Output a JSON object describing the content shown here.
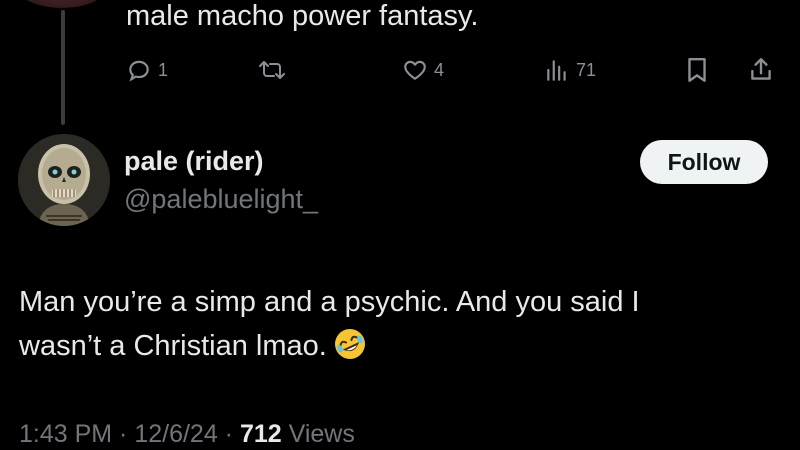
{
  "parent_tweet": {
    "text_tail": "male macho power fantasy.",
    "actions": {
      "reply": {
        "icon": "reply-icon",
        "count": "1"
      },
      "retweet": {
        "icon": "retweet-icon",
        "count": ""
      },
      "like": {
        "icon": "heart-icon",
        "count": "4"
      },
      "views": {
        "icon": "views-bar-chart-icon",
        "count": "71"
      },
      "bookmark": {
        "icon": "bookmark-icon"
      },
      "share": {
        "icon": "share-icon"
      }
    }
  },
  "tweet": {
    "author": {
      "display_name": "pale (rider)",
      "handle": "@palebluelight_"
    },
    "follow_label": "Follow",
    "text_line1": "Man you’re a simp and a psychic. And you said I",
    "text_line2": "wasn’t a Christian lmao.",
    "emoji": "rolling-on-floor-laughing-emoji",
    "timestamp": "1:43 PM · 12/6/24 · ",
    "views_count": "712",
    "views_label": " Views"
  },
  "colors": {
    "background": "#000000",
    "primary_text": "#e7e9ea",
    "secondary_text": "#71767b",
    "follow_button_bg": "#eff3f4",
    "follow_button_text": "#0f1419"
  }
}
